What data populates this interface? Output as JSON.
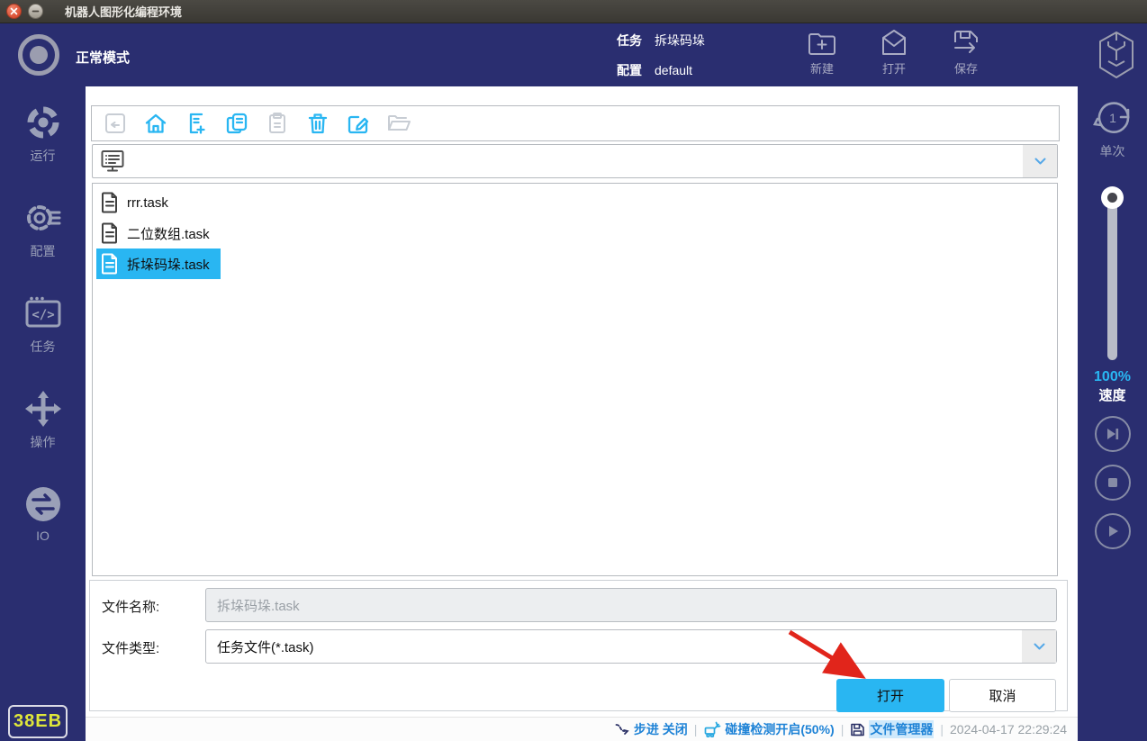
{
  "window": {
    "title": "机器人图形化编程环境"
  },
  "header": {
    "mode_label": "正常模式",
    "task_label": "任务",
    "task_value": "拆垛码垛",
    "config_label": "配置",
    "config_value": "default",
    "new_label": "新建",
    "open_label": "打开",
    "save_label": "保存"
  },
  "sidebar": {
    "items": [
      {
        "label": "运行"
      },
      {
        "label": "配置"
      },
      {
        "label": "任务"
      },
      {
        "label": "操作"
      },
      {
        "label": "IO"
      }
    ],
    "badge": "38EB"
  },
  "right_panel": {
    "single_label": "单次",
    "single_count": "1",
    "speed_value": "100%",
    "speed_label": "速度"
  },
  "file_dialog": {
    "files": [
      {
        "name": "rrr.task"
      },
      {
        "name": "二位数组.task"
      },
      {
        "name": "拆垛码垛.task"
      }
    ],
    "filename_label": "文件名称:",
    "filename_value": "拆垛码垛.task",
    "filetype_label": "文件类型:",
    "filetype_value": "任务文件(*.task)",
    "open_button": "打开",
    "cancel_button": "取消"
  },
  "statusbar": {
    "step_label": "步进 关闭",
    "collision_label": "碰撞检测开启(50%)",
    "file_manager_label": "文件管理器",
    "timestamp": "2024-04-17 22:29:24",
    "separator": "|"
  },
  "icons": {
    "task_glyph": "</>"
  },
  "colors": {
    "navy": "#2a2e70",
    "accent_cyan": "#29b6f2",
    "status_blue": "#1f83d6",
    "badge_text": "#dfe73a",
    "arrow_red": "#e1251b",
    "titlebar_close": "#d94e33"
  }
}
